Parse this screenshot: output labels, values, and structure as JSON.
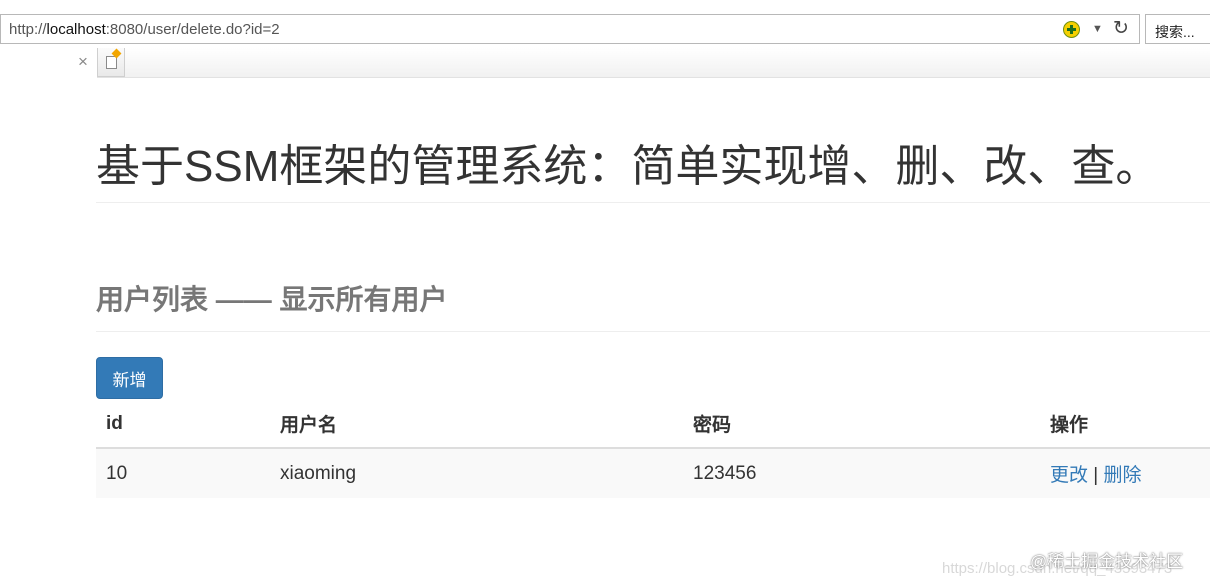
{
  "browser": {
    "url_prefix": "http://",
    "url_host": "localhost",
    "url_rest": ":8080/user/delete.do?id=2",
    "search_placeholder": "搜索...",
    "compat_icon": "compat-view-icon",
    "refresh_icon": "refresh-icon",
    "dropdown_glyph": "▼",
    "refresh_glyph": "↻",
    "close_glyph": "×"
  },
  "page": {
    "title": "基于SSM框架的管理系统：简单实现增、删、改、查。",
    "subtitle": "用户列表 —— 显示所有用户",
    "add_button": "新增"
  },
  "table": {
    "headers": {
      "id": "id",
      "username": "用户名",
      "password": "密码",
      "actions": "操作"
    },
    "rows": [
      {
        "id": "10",
        "username": "xiaoming",
        "password": "123456",
        "edit": "更改",
        "separator": "|",
        "delete": "删除"
      }
    ]
  },
  "watermark": {
    "url": "https://blog.csdn.net/qq_43593473",
    "brand": "@稀土掘金技术社区"
  },
  "colors": {
    "primary": "#337ab7",
    "text": "#333333",
    "muted": "#777777",
    "row_stripe": "#f9f9f9"
  }
}
